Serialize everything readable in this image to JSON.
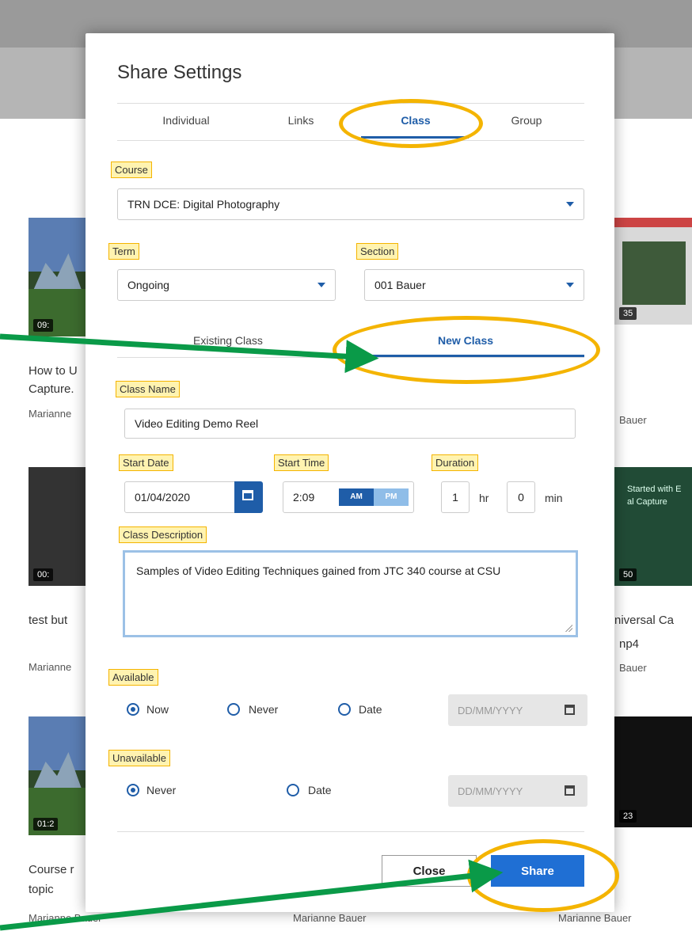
{
  "modal": {
    "title": "Share Settings",
    "tabs": [
      {
        "label": "Individual",
        "active": false
      },
      {
        "label": "Links",
        "active": false
      },
      {
        "label": "Class",
        "active": true
      },
      {
        "label": "Group",
        "active": false
      }
    ],
    "course": {
      "label": "Course",
      "value": "TRN DCE: Digital Photography"
    },
    "term": {
      "label": "Term",
      "value": "Ongoing"
    },
    "section": {
      "label": "Section",
      "value": "001 Bauer"
    },
    "class_tabs": [
      {
        "label": "Existing Class",
        "active": false
      },
      {
        "label": "New Class",
        "active": true
      }
    ],
    "class_name": {
      "label": "Class Name",
      "value": "Video Editing Demo Reel"
    },
    "start_date": {
      "label": "Start Date",
      "value": "01/04/2020"
    },
    "start_time": {
      "label": "Start Time",
      "value": "2:09",
      "am": "AM",
      "pm": "PM",
      "selected": "AM"
    },
    "duration": {
      "label": "Duration",
      "hours": "1",
      "hr_unit": "hr",
      "minutes": "0",
      "min_unit": "min"
    },
    "description": {
      "label": "Class Description",
      "value": "Samples of Video Editing Techniques gained from JTC 340 course at CSU"
    },
    "available": {
      "label": "Available",
      "options": [
        "Now",
        "Never",
        "Date"
      ],
      "selected": "Now",
      "date_placeholder": "DD/MM/YYYY"
    },
    "unavailable": {
      "label": "Unavailable",
      "options": [
        "Never",
        "Date"
      ],
      "selected": "Never",
      "date_placeholder": "DD/MM/YYYY"
    },
    "buttons": {
      "close": "Close",
      "share": "Share"
    }
  },
  "background": {
    "thumb_badges": [
      "09:",
      "00:",
      "01:2",
      "35",
      "50",
      "23"
    ],
    "video_titles": [
      "How to U",
      "Capture.",
      "test but",
      "Course r",
      "topic",
      "niversal Ca",
      "np4"
    ],
    "authors": [
      "Marianne",
      "Marianne",
      "Marianne Bauer",
      "Marianne Bauer",
      "Marianne Bauer",
      "Bauer",
      "Bauer"
    ],
    "right_thumb_text": [
      "Started with E",
      "al Capture"
    ]
  },
  "colors": {
    "accent": "#1f5da8",
    "highlight": "#f4b400",
    "arrow": "#0a9a48"
  }
}
